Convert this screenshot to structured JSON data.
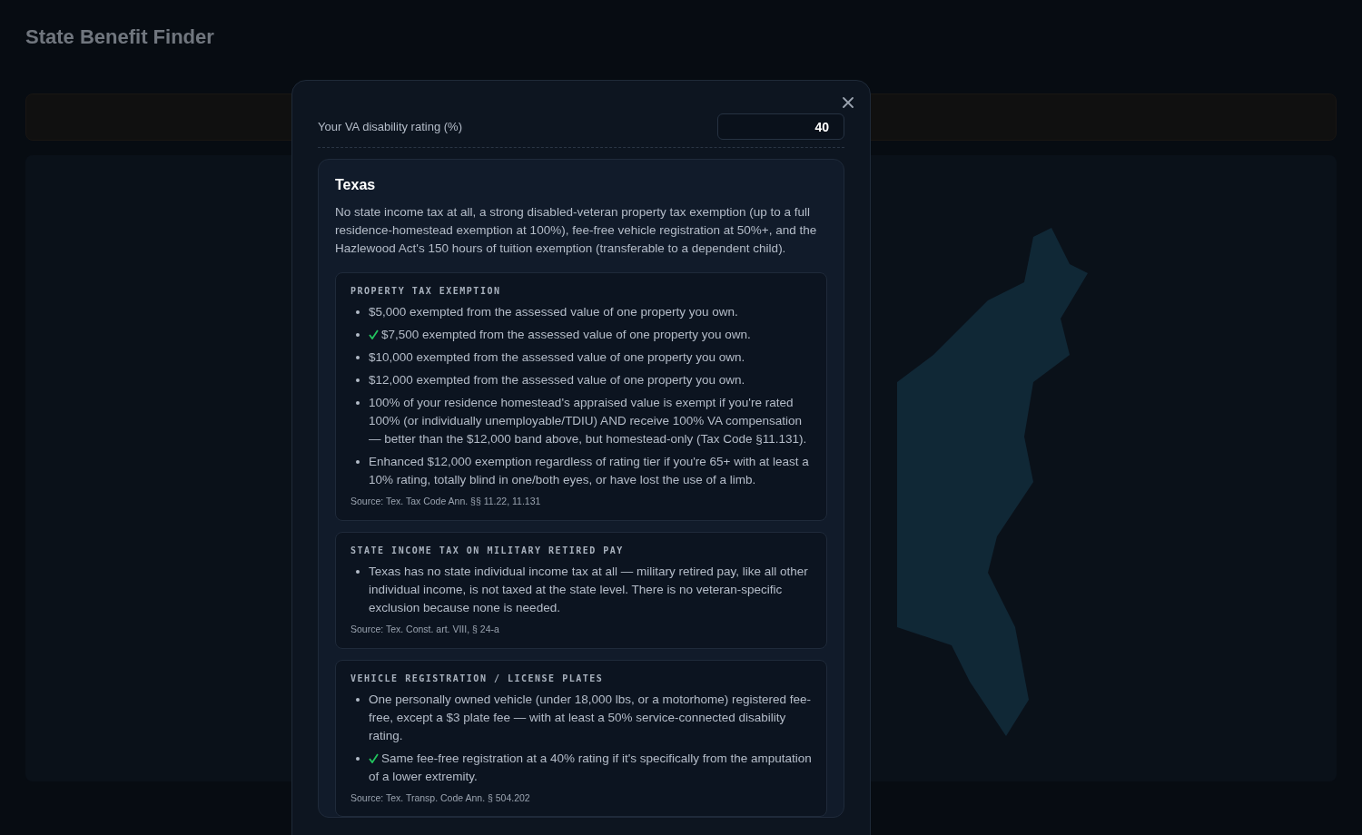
{
  "page": {
    "title": "State Benefit Finder"
  },
  "modal": {
    "rating": {
      "label": "Your VA disability rating (%)",
      "value": "40"
    },
    "state": {
      "name": "Texas",
      "summary": "No state income tax at all, a strong disabled-veteran property tax exemption (up to a full residence-homestead exemption at 100%), fee-free vehicle registration at 50%+, and the Hazlewood Act's 150 hours of tuition exemption (transferable to a dependent child).",
      "sections": [
        {
          "heading": "PROPERTY TAX EXEMPTION",
          "items": [
            {
              "text": "$5,000 exempted from the assessed value of one property you own.",
              "applies": false
            },
            {
              "text": "$7,500 exempted from the assessed value of one property you own.",
              "applies": true
            },
            {
              "text": "$10,000 exempted from the assessed value of one property you own.",
              "applies": false
            },
            {
              "text": "$12,000 exempted from the assessed value of one property you own.",
              "applies": false
            },
            {
              "text": "100% of your residence homestead's appraised value is exempt if you're rated 100% (or individually unemployable/TDIU) AND receive 100% VA compensation — better than the $12,000 band above, but homestead-only (Tax Code §11.131).",
              "applies": false
            },
            {
              "text": "Enhanced $12,000 exemption regardless of rating tier if you're 65+ with at least a 10% rating, totally blind in one/both eyes, or have lost the use of a limb.",
              "applies": false
            }
          ],
          "source": "Source: Tex. Tax Code Ann. §§ 11.22, 11.131"
        },
        {
          "heading": "STATE INCOME TAX ON MILITARY RETIRED PAY",
          "items": [
            {
              "text": "Texas has no state individual income tax at all — military retired pay, like all other individual income, is not taxed at the state level. There is no veteran-specific exclusion because none is needed.",
              "applies": false
            }
          ],
          "source": "Source: Tex. Const. art. VIII, § 24-a"
        },
        {
          "heading": "VEHICLE REGISTRATION / LICENSE PLATES",
          "items": [
            {
              "text": "One personally owned vehicle (under 18,000 lbs, or a motorhome) registered fee-free, except a $3 plate fee — with at least a 50% service-connected disability rating.",
              "applies": false
            },
            {
              "text": "Same fee-free registration at a 40% rating if it's specifically from the amputation of a lower extremity.",
              "applies": true
            }
          ],
          "source": "Source: Tex. Transp. Code Ann. § 504.202"
        }
      ]
    }
  }
}
